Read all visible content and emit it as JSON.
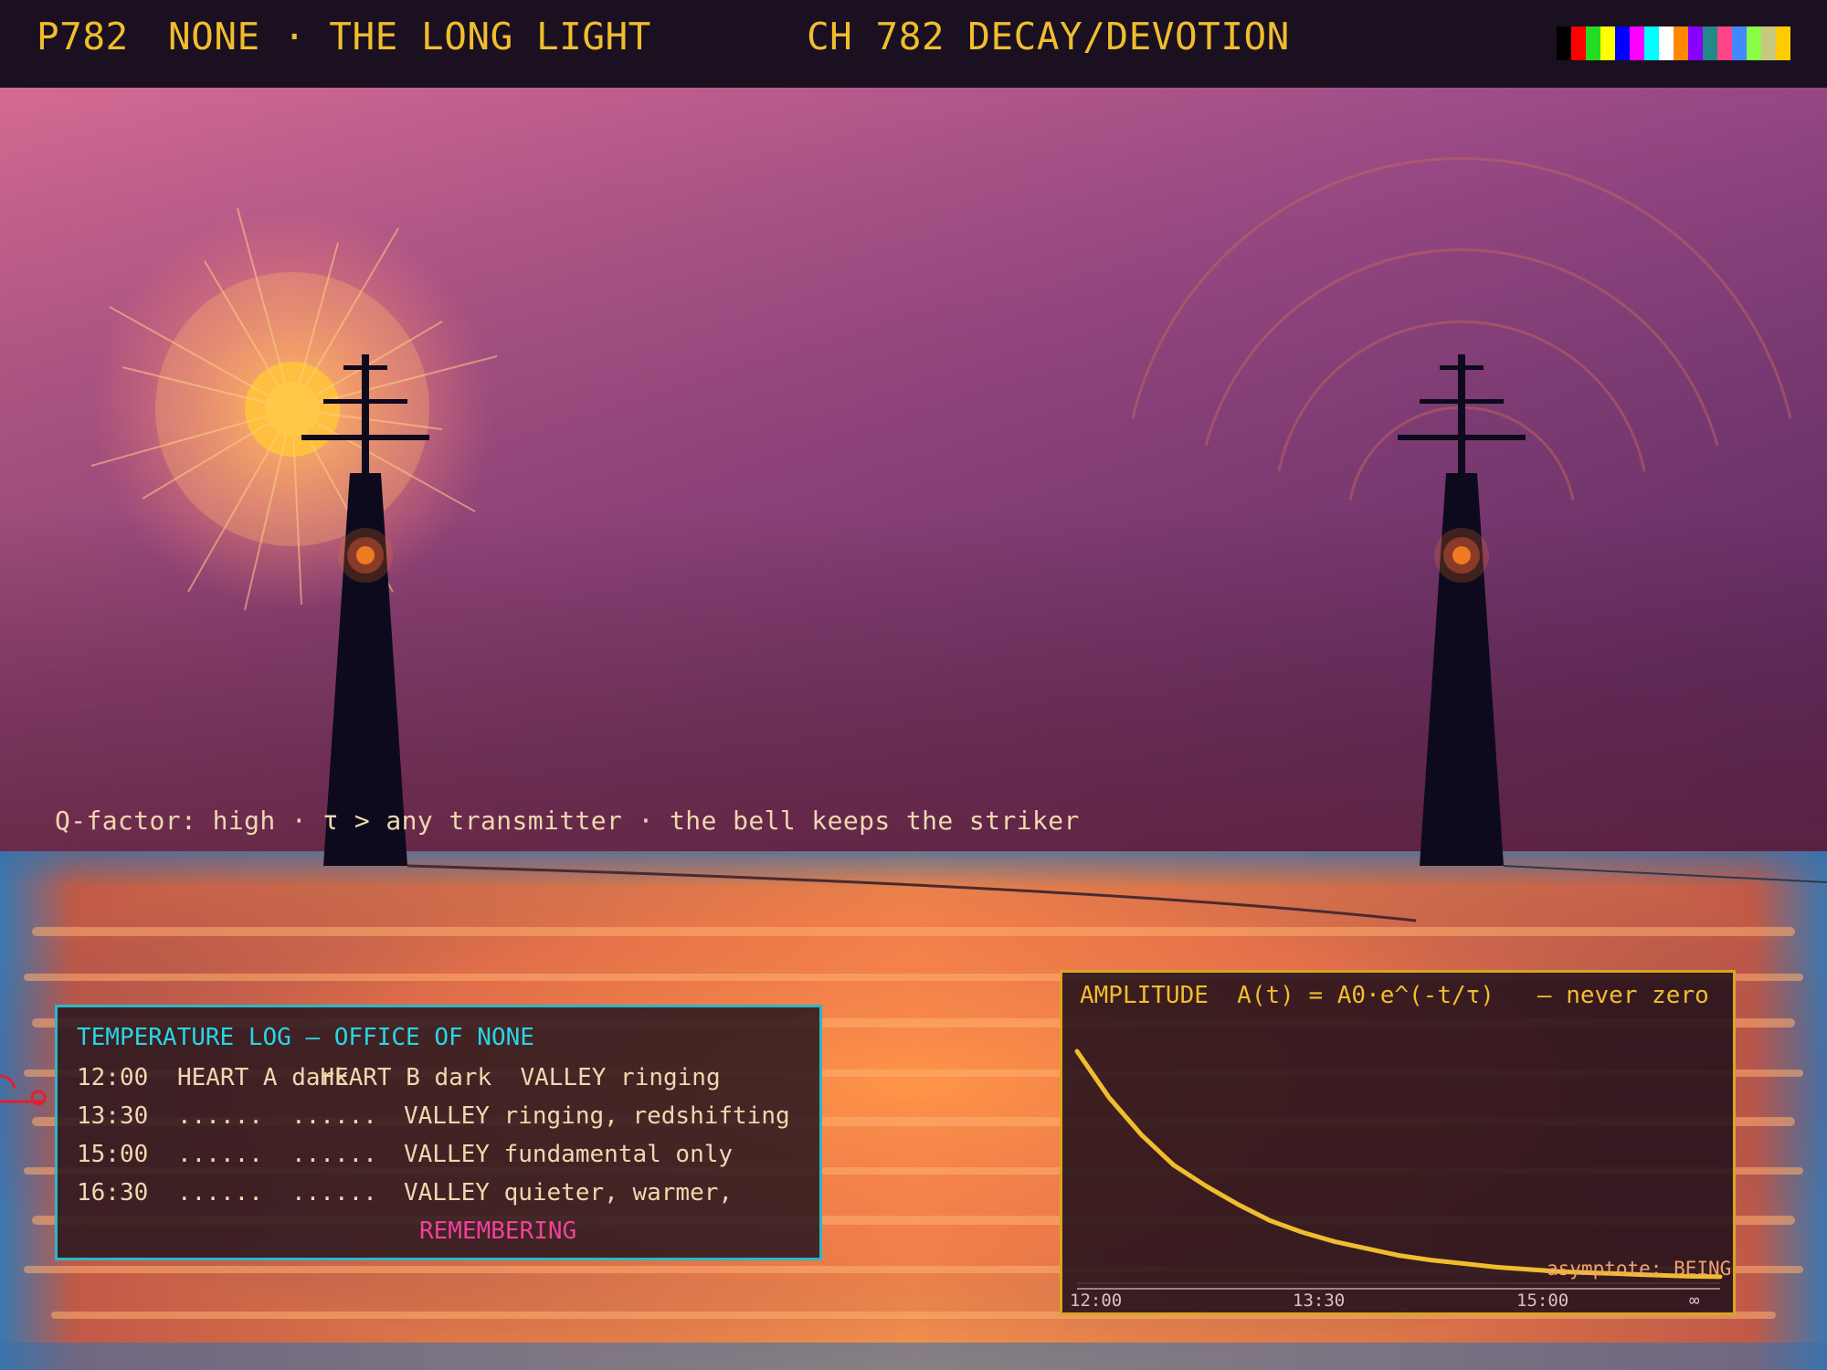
{
  "header": {
    "page_id": "P782",
    "channel_name": "NONE · THE LONG LIGHT",
    "channel_tag": "CH 782 DECAY/DEVOTION",
    "test_bar_colors": [
      "#000000",
      "#ff0000",
      "#22dd22",
      "#ffff00",
      "#0000ff",
      "#ff00ff",
      "#00ffff",
      "#ffffff",
      "#ff8800",
      "#8800ff",
      "#228888",
      "#ff4488",
      "#4488ff",
      "#88ff44",
      "#c8c880",
      "#ffcc00"
    ]
  },
  "scene": {
    "caption": "Q-factor: high · τ > any transmitter · the bell keeps the striker",
    "sun_icon": "sun-icon",
    "towers": [
      {
        "name": "heart-a",
        "icon": "radio-tower-icon"
      },
      {
        "name": "heart-b",
        "icon": "radio-tower-icon"
      }
    ],
    "colors": {
      "sky_top": "#d06a92",
      "sky_right": "#6a2e7e",
      "horizon": "#6a2238",
      "sea_glow": "#ff9a4a",
      "sea_edge": "#3a78b0",
      "tower": "#0e0a1e",
      "beacon": "#f07a20"
    }
  },
  "temperature_log": {
    "title": "TEMPERATURE LOG — OFFICE OF NONE",
    "rows": [
      {
        "time": "12:00",
        "a": "HEART A dark",
        "b": "HEART B dark",
        "valley": "VALLEY ringing"
      },
      {
        "time": "13:30",
        "a": "......",
        "b": "......",
        "valley": "VALLEY ringing, redshifting"
      },
      {
        "time": "15:00",
        "a": "......",
        "b": "......",
        "valley": "VALLEY fundamental only"
      },
      {
        "time": "16:30",
        "a": "......",
        "b": "......",
        "valley": "VALLEY quieter, warmer,"
      }
    ],
    "continuation": "REMEMBERING",
    "border_color": "#2bb8c8",
    "accent_color": "#f0429a"
  },
  "chart_data": {
    "type": "line",
    "title": "AMPLITUDE  A(t) = A0·e^(-t/τ)   — never zero",
    "x_tick_labels": [
      "12:00",
      "13:30",
      "15:00",
      "∞"
    ],
    "annotation": "asymptote: BEING",
    "ylim": [
      0,
      1
    ],
    "grid": false,
    "series": [
      {
        "color": "#f0bd2e",
        "x": [
          0,
          0.05,
          0.1,
          0.15,
          0.2,
          0.25,
          0.3,
          0.35,
          0.4,
          0.45,
          0.5,
          0.55,
          0.6,
          0.65,
          0.7,
          0.75,
          0.8,
          0.85,
          0.9,
          0.95,
          1.0
        ],
        "values": [
          1.0,
          0.8,
          0.64,
          0.51,
          0.42,
          0.34,
          0.27,
          0.22,
          0.18,
          0.15,
          0.12,
          0.1,
          0.085,
          0.07,
          0.06,
          0.05,
          0.045,
          0.04,
          0.035,
          0.03,
          0.028
        ]
      }
    ]
  }
}
